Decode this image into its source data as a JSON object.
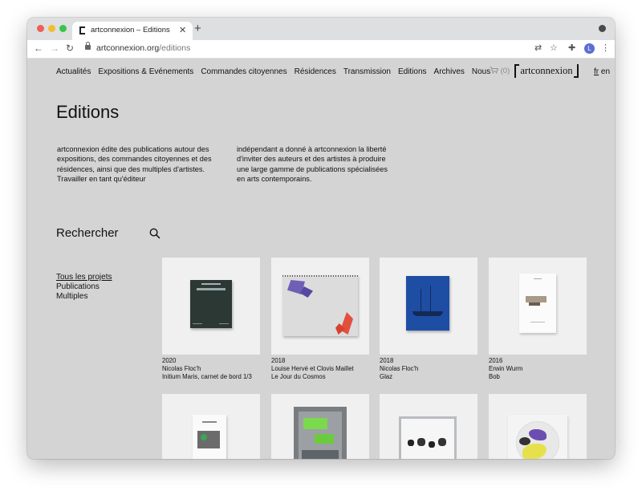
{
  "browser": {
    "tab_title": "artconnexion – Editions",
    "url_domain": "artconnexion.org",
    "url_path": "/editions",
    "profile_initial": "L"
  },
  "header": {
    "nav": [
      "Actualités",
      "Expositions & Evénements",
      "Commandes citoyennes",
      "Résidences",
      "Transmission",
      "Editions",
      "Archives",
      "Nous"
    ],
    "cart": "(0)",
    "logo": "artconnexion",
    "lang_active": "fr",
    "lang_other": "en"
  },
  "main": {
    "title": "Editions",
    "intro_left": "artconnexion édite des publications autour des expositions, des commandes citoyennes et des résidences, ainsi que des multiples d'artistes. Travailler en tant qu'éditeur",
    "intro_right": "indépendant a donné à artconnexion la liberté d'inviter des auteurs et des artistes à produire une large gamme de publications spécialisées en arts contemporains.",
    "search_label": "Rechercher"
  },
  "filters": [
    "Tous les projets",
    "Publications",
    "Multiples"
  ],
  "items": [
    {
      "year": "2020",
      "author": "Nicolas Floc'h",
      "title": "Initium Maris, carnet de bord 1/3"
    },
    {
      "year": "2018",
      "author": "Louise Hervé et Clovis Maillet",
      "title": "Le Jour du Cosmos"
    },
    {
      "year": "2018",
      "author": "Nicolas Floc'h",
      "title": "Glaz"
    },
    {
      "year": "2016",
      "author": "Erwin Wurm",
      "title": "Bob"
    }
  ],
  "colors": {
    "page_bg": "#d4d4d4",
    "thumb_bg": "#f0f0f0",
    "text": "#111111"
  }
}
